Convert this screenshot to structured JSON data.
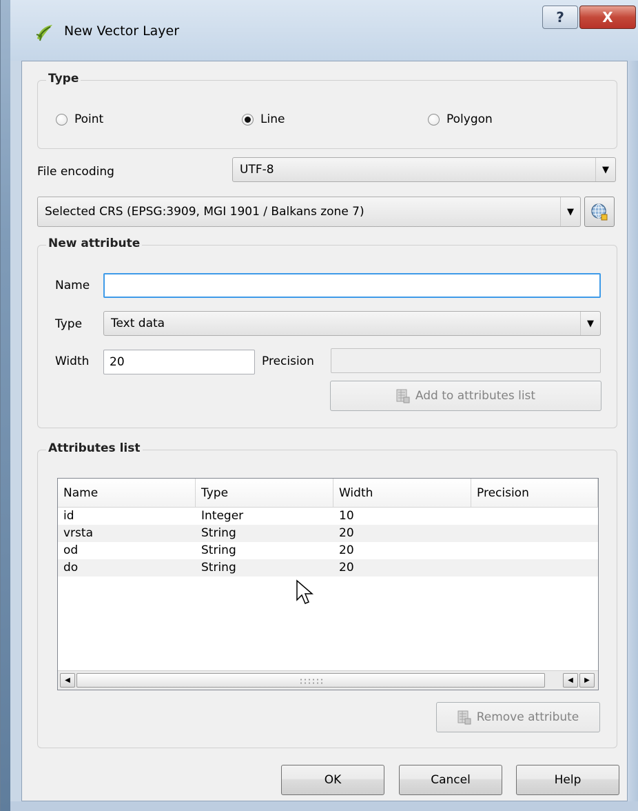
{
  "window": {
    "title": "New Vector Layer",
    "help_button": "?",
    "close_button": "X"
  },
  "type_group": {
    "title": "Type",
    "options": [
      {
        "label": "Point",
        "selected": false
      },
      {
        "label": "Line",
        "selected": true
      },
      {
        "label": "Polygon",
        "selected": false
      }
    ]
  },
  "file_encoding": {
    "label": "File encoding",
    "value": "UTF-8"
  },
  "crs": {
    "value": "Selected CRS (EPSG:3909, MGI 1901 / Balkans zone 7)"
  },
  "new_attribute": {
    "title": "New attribute",
    "name_label": "Name",
    "name_value": "",
    "type_label": "Type",
    "type_value": "Text data",
    "width_label": "Width",
    "width_value": "20",
    "precision_label": "Precision",
    "precision_value": "",
    "add_button": "Add to attributes list"
  },
  "attributes_list": {
    "title": "Attributes list",
    "columns": [
      "Name",
      "Type",
      "Width",
      "Precision"
    ],
    "rows": [
      [
        "id",
        "Integer",
        "10",
        ""
      ],
      [
        "vrsta",
        "String",
        "20",
        ""
      ],
      [
        "od",
        "String",
        "20",
        ""
      ],
      [
        "do",
        "String",
        "20",
        ""
      ]
    ],
    "remove_button": "Remove attribute"
  },
  "footer": {
    "ok": "OK",
    "cancel": "Cancel",
    "help": "Help"
  }
}
